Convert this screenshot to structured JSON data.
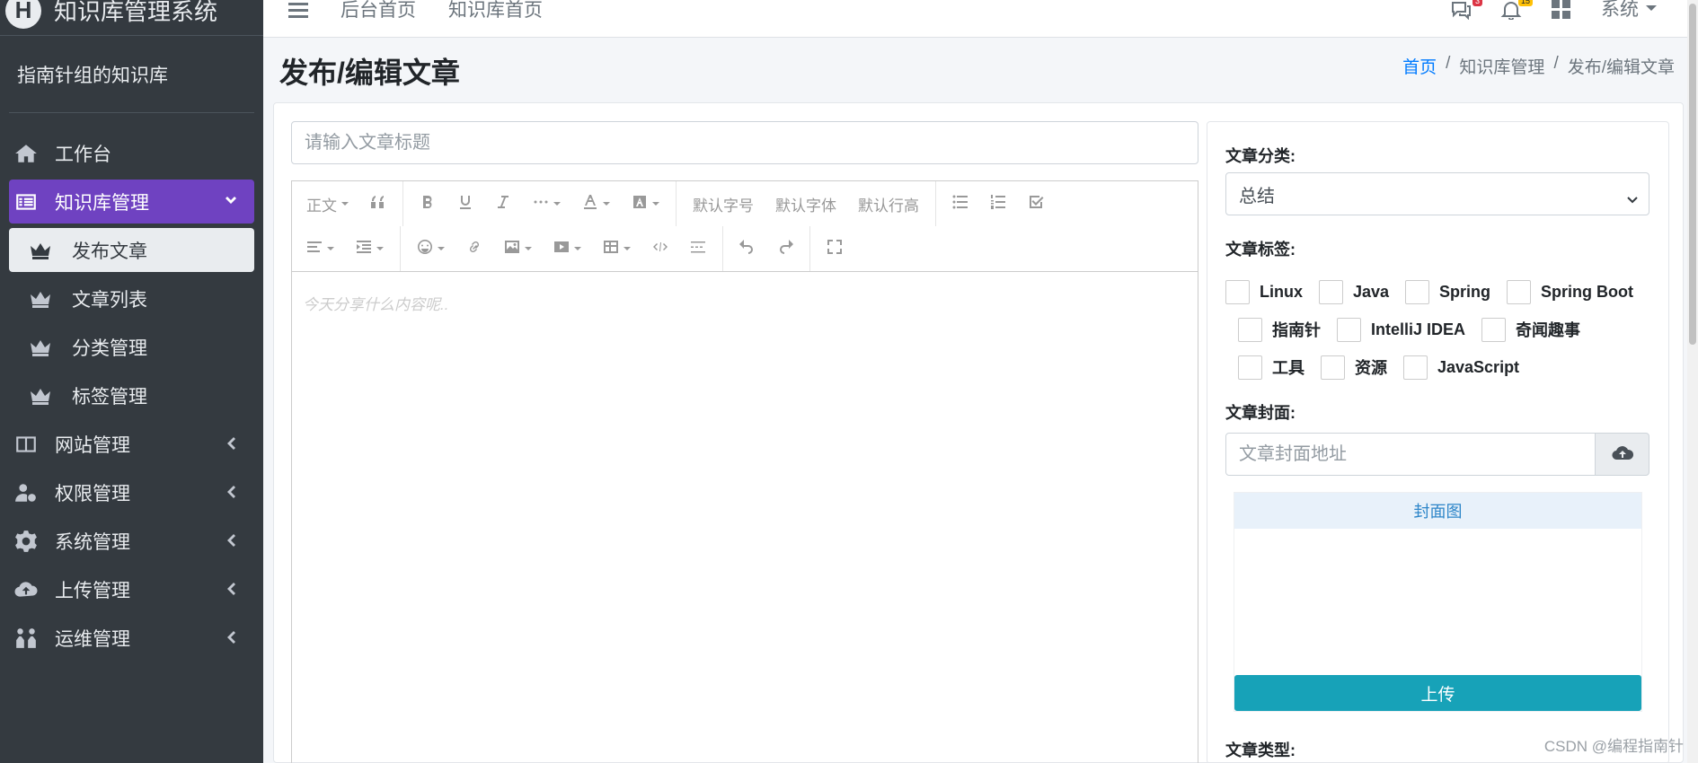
{
  "brand": {
    "logo_letter": "H",
    "name": "知识库管理系统"
  },
  "user_panel": {
    "name": "指南针组的知识库"
  },
  "sidebar": {
    "items": [
      {
        "label": "工作台",
        "icon": "home-icon"
      },
      {
        "label": "知识库管理",
        "icon": "list-alt-icon",
        "active": true,
        "children": [
          {
            "label": "发布文章",
            "active": true
          },
          {
            "label": "文章列表"
          },
          {
            "label": "分类管理"
          },
          {
            "label": "标签管理"
          }
        ]
      },
      {
        "label": "网站管理",
        "icon": "columns-icon"
      },
      {
        "label": "权限管理",
        "icon": "user-cog-icon"
      },
      {
        "label": "系统管理",
        "icon": "gear-icon"
      },
      {
        "label": "上传管理",
        "icon": "cloud-upload-icon"
      },
      {
        "label": "运维管理",
        "icon": "people-icon"
      }
    ]
  },
  "topbar": {
    "links": [
      "后台首页",
      "知识库首页"
    ],
    "message_badge": "3",
    "notification_badge": "15",
    "system_menu": "系统"
  },
  "page": {
    "title": "发布/编辑文章",
    "breadcrumb": [
      "首页",
      "知识库管理",
      "发布/编辑文章"
    ]
  },
  "editor": {
    "title_placeholder": "请输入文章标题",
    "content_placeholder": "今天分享什么内容呢..",
    "toolbar": {
      "heading": "正文",
      "font_size": "默认字号",
      "font_family": "默认字体",
      "line_height": "默认行高"
    }
  },
  "side_panel": {
    "category_label": "文章分类:",
    "category_value": "总结",
    "tags_label": "文章标签:",
    "tag_rows": [
      [
        "Linux",
        "Java",
        "Spring",
        "Spring Boot"
      ],
      [
        "指南针",
        "IntelliJ IDEA",
        "奇闻趣事"
      ],
      [
        "工具",
        "资源",
        "JavaScript"
      ]
    ],
    "cover_label": "文章封面:",
    "cover_placeholder": "文章封面地址",
    "cover_preview_title": "封面图",
    "upload_button": "上传",
    "type_label": "文章类型:"
  },
  "watermark": "CSDN @编程指南针",
  "colors": {
    "sidebar_bg": "#343a40",
    "active_nav": "#6f42c1",
    "upload_btn": "#17a2b8",
    "link": "#007bff"
  }
}
